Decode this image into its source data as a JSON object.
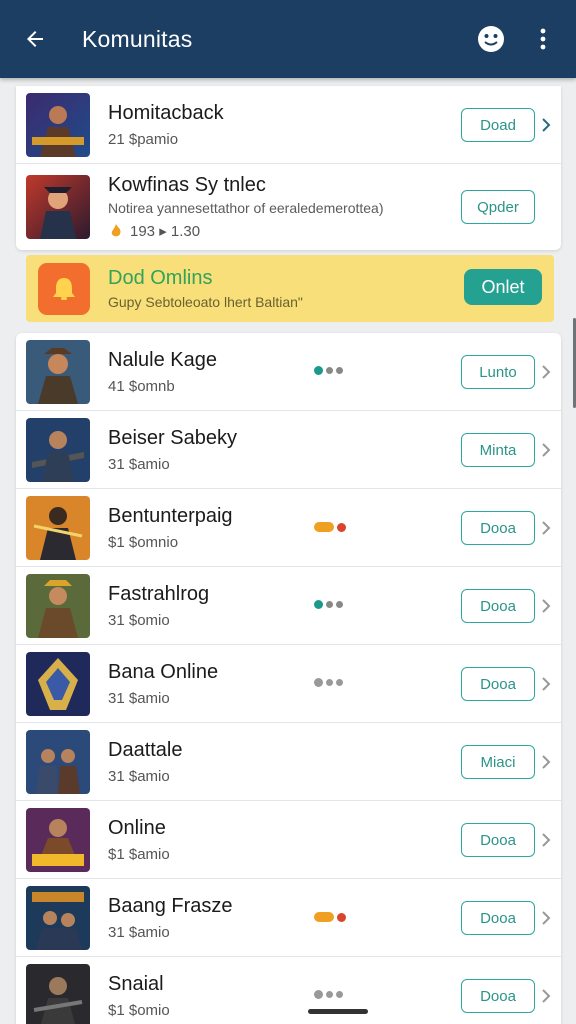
{
  "appbar": {
    "title": "Komunitas"
  },
  "top_items": [
    {
      "title": "Homitacback",
      "sub": "21 $pamio",
      "button": "Doad"
    },
    {
      "title": "Kowfinas Sy tnlec",
      "desc": "Notirea yannesettathor of eeraledemerottea)",
      "sub": "193   ▸ 1.30",
      "button": "Qpder"
    }
  ],
  "promo": {
    "title": "Dod Omlins",
    "subtitle": "Gupy Sebtoleoato lhert Baltian\"",
    "button": "Onlet"
  },
  "list_items": [
    {
      "title": "Nalule Kage",
      "sub": "41 $omnb",
      "button": "Lunto"
    },
    {
      "title": "Beiser Sabeky",
      "sub": "31 $amio",
      "button": "Minta"
    },
    {
      "title": "Bentunterpaig",
      "sub": "$1 $omnio",
      "button": "Dooa"
    },
    {
      "title": "Fastrahlrog",
      "sub": "31 $omio",
      "button": "Dooa"
    },
    {
      "title": "Bana Online",
      "sub": "31 $amio",
      "button": "Dooa"
    },
    {
      "title": "Daattale",
      "sub": "31 $amio",
      "button": "Miaci"
    },
    {
      "title": "Online",
      "sub": "$1 $amio",
      "button": "Dooa"
    },
    {
      "title": "Baang Frasze",
      "sub": "31 $amio",
      "button": "Dooa"
    },
    {
      "title": "Snaial",
      "sub": "$1 $omio",
      "button": "Dooa"
    }
  ],
  "colors": {
    "appbar": "#1c3e63",
    "accent": "#2da89e",
    "promo_bg": "#f8df79"
  },
  "icons": [
    "arrow-back-icon",
    "emoji-icon",
    "more-vert-icon",
    "chevron-right-icon",
    "bell-icon"
  ]
}
